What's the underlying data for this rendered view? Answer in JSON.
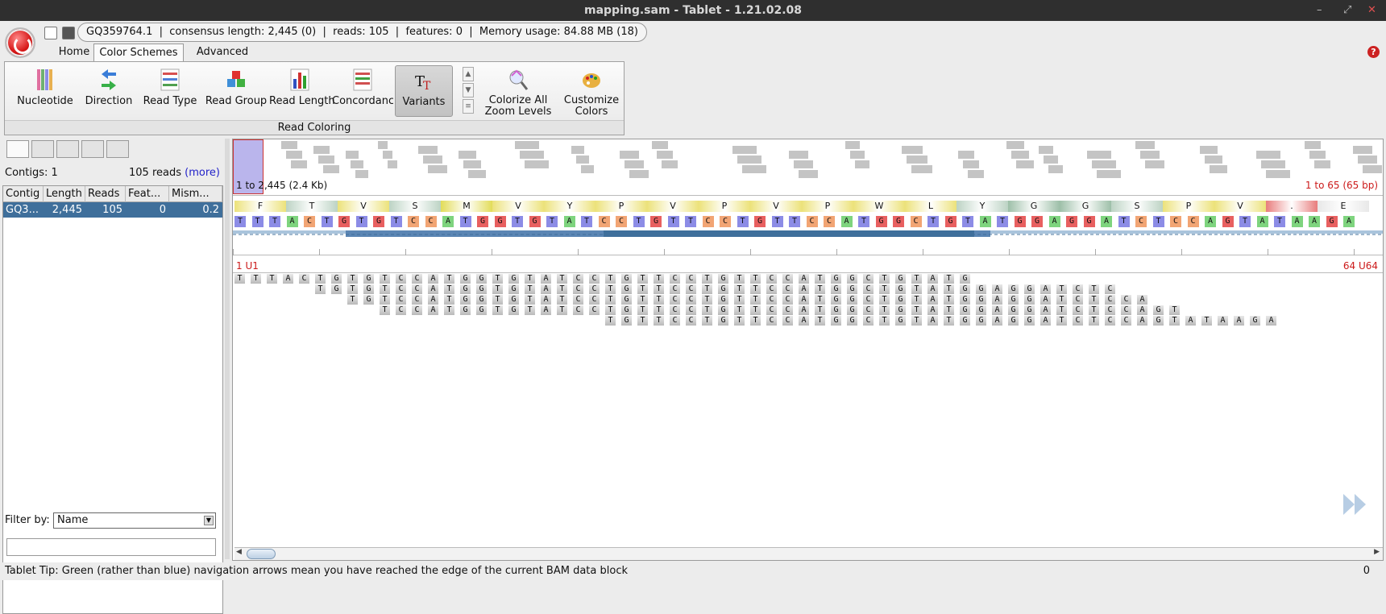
{
  "window": {
    "title": "mapping.sam - Tablet - 1.21.02.08",
    "controls": [
      "–",
      "⤢",
      "✕"
    ]
  },
  "info": {
    "contig": "GQ359764.1",
    "consensus": "consensus length: 2,445 (0)",
    "reads": "reads: 105",
    "features": "features: 0",
    "memory": "Memory usage: 84.88 MB (18)"
  },
  "tabs": [
    "Home",
    "Color Schemes",
    "Advanced"
  ],
  "ribbon": {
    "buttons": [
      "Nucleotide",
      "Direction",
      "Read Type",
      "Read Group",
      "Read Length",
      "Concordance",
      "Variants"
    ],
    "colorize": [
      "Colorize All",
      "Zoom Levels"
    ],
    "customize": [
      "Customize",
      "Colors"
    ],
    "group_label": "Read Coloring"
  },
  "left": {
    "contigs": "Contigs: 1",
    "reads_count": "105 reads",
    "more": "(more)",
    "columns": [
      "Contig",
      "Length",
      "Reads",
      "Feat...",
      "Mism..."
    ],
    "row": [
      "GQ3...",
      "2,445",
      "105",
      "0",
      "0.2"
    ],
    "filter_label": "Filter by:",
    "filter_value": "Name"
  },
  "overview": {
    "range_left": "1 to 2,445 (2.4 Kb)",
    "range_right": "1 to 65 (65 bp)"
  },
  "translation": [
    "F",
    "T",
    "V",
    "S",
    "M",
    "V",
    "Y",
    "P",
    "V",
    "P",
    "V",
    "P",
    "W",
    "L",
    "Y",
    "G",
    "G",
    "S",
    "P",
    "V",
    ".",
    "E"
  ],
  "consensus_seq": "TTTACTGTGTCCATGGTGTATCCTGTTCCTGTTCCATGGCTGTATGGAGGATCTCCAGTATAAGA",
  "position": {
    "left": "1 U1",
    "right": "64 U64"
  },
  "reads": [
    {
      "start": 0,
      "seq": "TTTACTGTGTCCATGGTGTATCCTGTTCCTGTTCCATGGCTGTATG"
    },
    {
      "start": 5,
      "seq": "TGTGTCCATGGTGTATCCTGTTCCTGTTCCATGGCTGTATGGAGGATCTC"
    },
    {
      "start": 7,
      "seq": "TGTCCATGGTGTATCCTGTTCCTGTTCCATGGCTGTATGGAGGATCTCCA"
    },
    {
      "start": 9,
      "seq": "TCCATGGTGTATCCTGTTCCTGTTCCATGGCTGTATGGAGGATCTCCAGT"
    },
    {
      "start": 23,
      "seq": "TGTTCCTGTTCCATGGCTGTATGGAGGATCTCCAGTATAAGA"
    }
  ],
  "status": {
    "tip": "Tablet Tip: Green (rather than blue) navigation arrows mean you have reached the edge of the current BAM data block",
    "num": "0"
  },
  "colors": {
    "A": "#7ed47e",
    "C": "#f2a574",
    "G": "#e86060",
    "T": "#8c8ce6",
    "selection": "#3f6f9b"
  }
}
